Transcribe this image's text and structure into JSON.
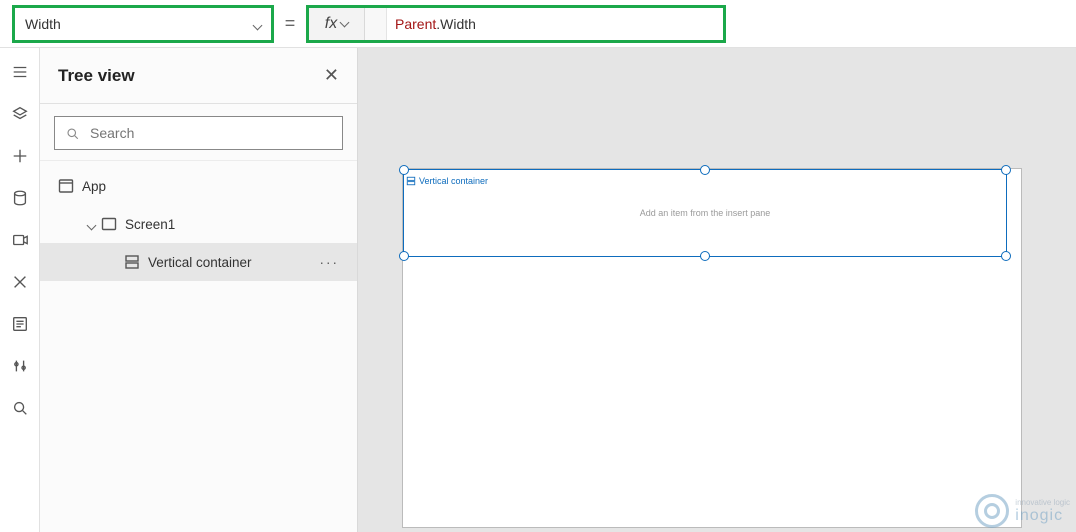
{
  "formula_bar": {
    "property": "Width",
    "fx_label": "fx",
    "formula_tokens": {
      "obj": "Parent",
      "dot": ".",
      "member": "Width"
    }
  },
  "left_rail": {
    "icons": [
      "hamburger",
      "layers",
      "plus",
      "database",
      "media",
      "variables",
      "advanced",
      "settings",
      "search"
    ]
  },
  "tree_panel": {
    "title": "Tree view",
    "search_placeholder": "Search",
    "nodes": {
      "app": {
        "label": "App"
      },
      "screen": {
        "label": "Screen1"
      },
      "container": {
        "label": "Vertical container"
      }
    }
  },
  "canvas": {
    "selected_control_label": "Vertical container",
    "hint": "Add an item from the insert pane"
  },
  "watermark": {
    "brand": "inogic",
    "tag": "innovative logic"
  }
}
